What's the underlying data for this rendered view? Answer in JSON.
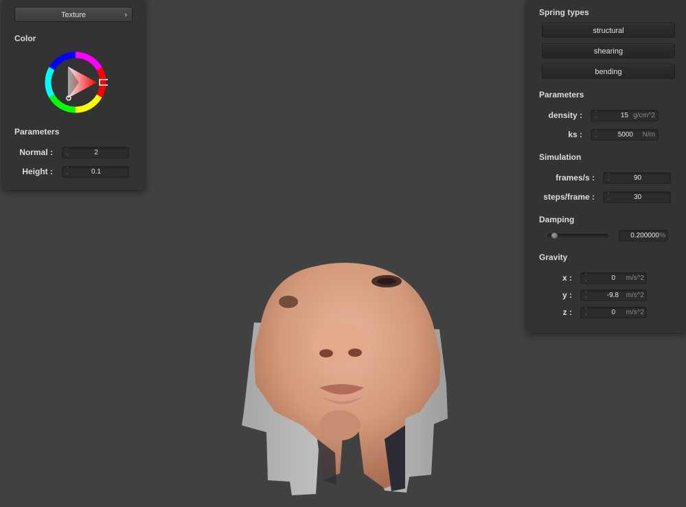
{
  "left_panel": {
    "texture_button": "Texture",
    "texture_chevron": "›",
    "color_title": "Color",
    "color_wheel": {
      "selected_hue": "#ff0000"
    },
    "parameters_title": "Parameters",
    "normal": {
      "label": "Normal :",
      "value": "2"
    },
    "height": {
      "label": "Height :",
      "value": "0.1"
    }
  },
  "right_panel": {
    "spring_types_title": "Spring types",
    "spring_buttons": [
      "structural",
      "shearing",
      "bending"
    ],
    "parameters_title": "Parameters",
    "density": {
      "label": "density :",
      "value": "15",
      "unit": "g/cm^2"
    },
    "ks": {
      "label": "ks :",
      "value": "5000",
      "unit": "N/m"
    },
    "simulation_title": "Simulation",
    "frames": {
      "label": "frames/s :",
      "value": "90"
    },
    "steps": {
      "label": "steps/frame :",
      "value": "30"
    },
    "damping_title": "Damping",
    "damping": {
      "value": "0.200000",
      "unit": "%",
      "slider_fraction": 0.1
    },
    "gravity_title": "Gravity",
    "gravity": [
      {
        "label": "x :",
        "value": "0",
        "unit": "m/s^2"
      },
      {
        "label": "y :",
        "value": "-9.8",
        "unit": "m/s^2"
      },
      {
        "label": "z :",
        "value": "0",
        "unit": "m/s^2"
      }
    ]
  },
  "colors": {
    "background": "#414141",
    "panel": "#333333",
    "cloth_back": "#bdbdbd",
    "skin": "#d9a080"
  }
}
